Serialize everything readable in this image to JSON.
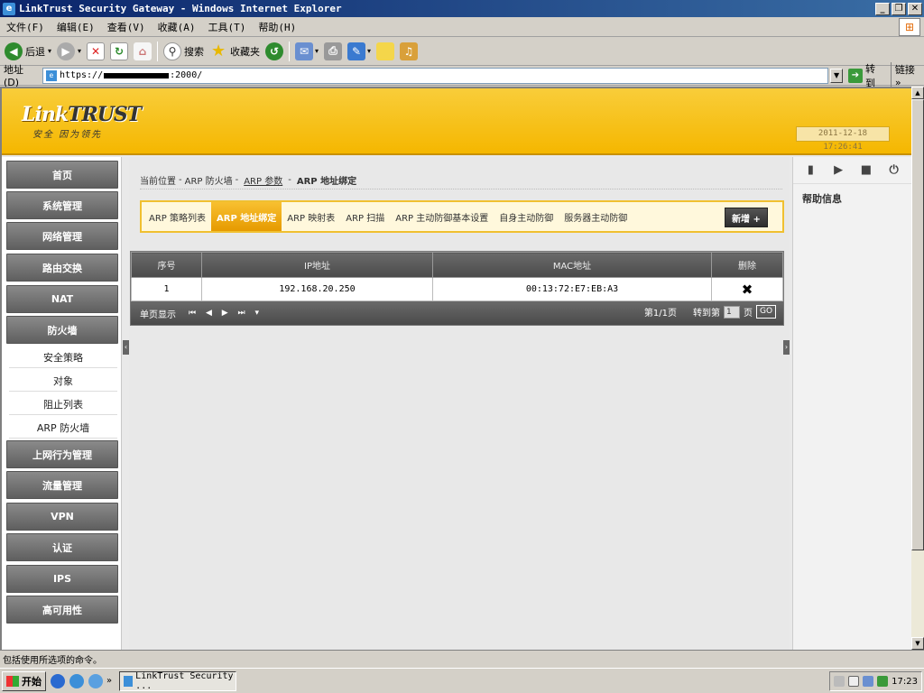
{
  "window": {
    "title": "LinkTrust Security Gateway - Windows Internet Explorer"
  },
  "menu": [
    "文件(F)",
    "编辑(E)",
    "查看(V)",
    "收藏(A)",
    "工具(T)",
    "帮助(H)"
  ],
  "toolbar": {
    "back": "后退",
    "search": "搜索",
    "favorites": "收藏夹"
  },
  "address": {
    "label": "地址(D)",
    "prefix": "https://",
    "suffix": ":2000/",
    "go": "转到",
    "links": "链接"
  },
  "header": {
    "brand_link": "Link",
    "brand_trust": "TRUST",
    "slogan": "安全 因为领先",
    "datetime": "2011-12-18 17:26:41"
  },
  "nav": [
    {
      "label": "首页",
      "type": "main"
    },
    {
      "label": "系统管理",
      "type": "main"
    },
    {
      "label": "网络管理",
      "type": "main"
    },
    {
      "label": "路由交换",
      "type": "main"
    },
    {
      "label": "NAT",
      "type": "main"
    },
    {
      "label": "防火墙",
      "type": "main"
    },
    {
      "label": "安全策略",
      "type": "sub"
    },
    {
      "label": "对象",
      "type": "sub"
    },
    {
      "label": "阻止列表",
      "type": "sub"
    },
    {
      "label": "ARP 防火墙",
      "type": "sub"
    },
    {
      "label": "上网行为管理",
      "type": "main"
    },
    {
      "label": "流量管理",
      "type": "main"
    },
    {
      "label": "VPN",
      "type": "main"
    },
    {
      "label": "认证",
      "type": "main"
    },
    {
      "label": "IPS",
      "type": "main"
    },
    {
      "label": "高可用性",
      "type": "main"
    }
  ],
  "breadcrumb": {
    "prefix": "当前位置",
    "sep": "-",
    "item1": "ARP 防火墙",
    "item2": "ARP 参数",
    "current": "ARP 地址绑定"
  },
  "tabs": [
    "ARP 策略列表",
    "ARP 地址绑定",
    "ARP 映射表",
    "ARP 扫描",
    "ARP 主动防御基本设置",
    "自身主动防御",
    "服务器主动防御"
  ],
  "active_tab": 1,
  "add_button": "新增 +",
  "table": {
    "headers": [
      "序号",
      "IP地址",
      "MAC地址",
      "删除"
    ],
    "rows": [
      {
        "index": "1",
        "ip": "192.168.20.250",
        "mac": "00:13:72:E7:EB:A3"
      }
    ]
  },
  "pager": {
    "display": "单页显示",
    "page_info": "第1/1页",
    "goto_label": "转到第",
    "page_input": "1",
    "page_unit": "页",
    "go": "GO"
  },
  "help": {
    "title": "帮助信息"
  },
  "status": "包括使用所选项的命令。",
  "taskbar": {
    "start": "开始",
    "task": "LinkTrust Security ...",
    "time": "17:23"
  }
}
